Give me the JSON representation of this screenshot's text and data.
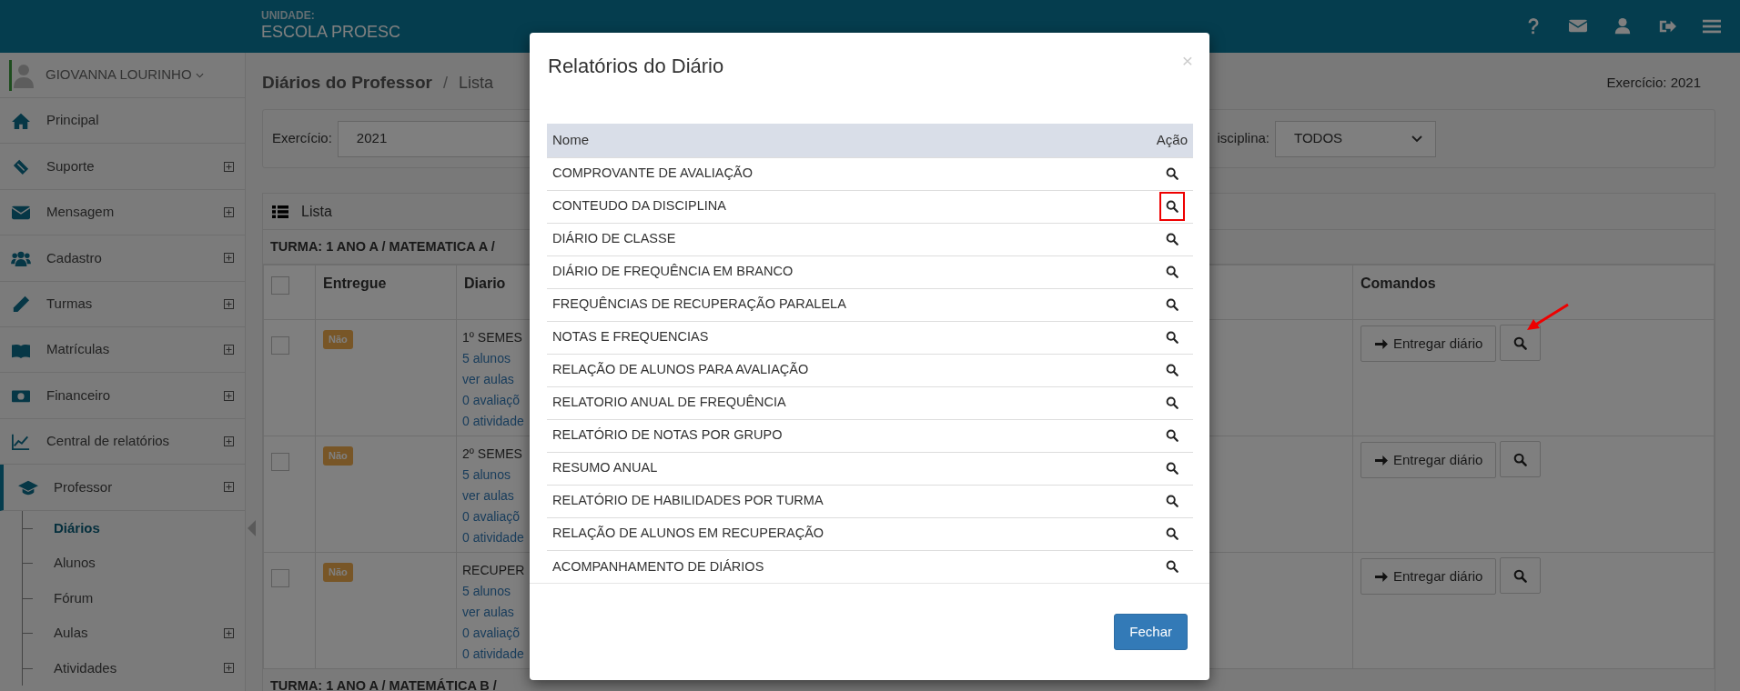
{
  "header": {
    "unit_label": "UNIDADE:",
    "unit_name": "ESCOLA PROESC"
  },
  "user": {
    "name": "GIOVANNA LOURINHO"
  },
  "sidebar": {
    "items": [
      {
        "label": "Principal",
        "expandable": false,
        "selected": false
      },
      {
        "label": "Suporte",
        "expandable": true,
        "selected": false
      },
      {
        "label": "Mensagem",
        "expandable": true,
        "selected": false
      },
      {
        "label": "Cadastro",
        "expandable": true,
        "selected": false
      },
      {
        "label": "Turmas",
        "expandable": true,
        "selected": false
      },
      {
        "label": "Matrículas",
        "expandable": true,
        "selected": false
      },
      {
        "label": "Financeiro",
        "expandable": true,
        "selected": false
      },
      {
        "label": "Central de relatórios",
        "expandable": true,
        "selected": false
      },
      {
        "label": "Professor",
        "expandable": true,
        "selected": true,
        "children": [
          {
            "label": "Diários",
            "expandable": false,
            "selected": true
          },
          {
            "label": "Alunos",
            "expandable": false,
            "selected": false
          },
          {
            "label": "Fórum",
            "expandable": false,
            "selected": false
          },
          {
            "label": "Aulas",
            "expandable": true,
            "selected": false
          },
          {
            "label": "Atividades",
            "expandable": true,
            "selected": false
          }
        ]
      }
    ]
  },
  "breadcrumb": {
    "title": "Diários do Professor",
    "separator": "/",
    "current": "Lista"
  },
  "exercise_label": "Exercício: 2021",
  "filters": [
    {
      "label": "Exercício:",
      "value": "2021"
    },
    {
      "label": "isciplina:",
      "value": "TODOS"
    }
  ],
  "list": {
    "title": "Lista",
    "groups": [
      {
        "title": "TURMA: 1 ANO A / MATEMATICA A /",
        "select_all_checked": false,
        "columns": [
          "Entregue",
          "Diario",
          "Comandos"
        ],
        "rows": [
          {
            "checked": false,
            "delivered": "Não",
            "diary": "1º SEMES",
            "links": [
              "5 alunos",
              "ver aulas",
              "0 avaliaçõ",
              "0 atividade"
            ],
            "deliver_button": "Entregar diário"
          },
          {
            "checked": false,
            "delivered": "Não",
            "diary": "2º SEMES",
            "links": [
              "5 alunos",
              "ver aulas",
              "0 avaliaçõ",
              "0 atividade"
            ],
            "deliver_button": "Entregar diário"
          },
          {
            "checked": false,
            "delivered": "Não",
            "diary": "RECUPER",
            "links": [
              "5 alunos",
              "ver aulas",
              "0 avaliaçõ",
              "0 atividade"
            ],
            "deliver_button": "Entregar diário"
          }
        ]
      },
      {
        "title": "TURMA: 1 ANO A / MATEMÁTICA B /"
      }
    ]
  },
  "modal": {
    "title": "Relatórios do Diário",
    "close": "×",
    "columns": [
      "Nome",
      "Ação"
    ],
    "reports": [
      {
        "name": "COMPROVANTE DE AVALIAÇÃO",
        "highlighted": false
      },
      {
        "name": "CONTEUDO DA DISCIPLINA",
        "highlighted": true
      },
      {
        "name": "DIÁRIO DE CLASSE",
        "highlighted": false
      },
      {
        "name": "DIÁRIO DE FREQUÊNCIA EM BRANCO",
        "highlighted": false
      },
      {
        "name": "FREQUÊNCIAS DE RECUPERAÇÃO PARALELA",
        "highlighted": false
      },
      {
        "name": "NOTAS E FREQUENCIAS",
        "highlighted": false
      },
      {
        "name": "RELAÇÃO DE ALUNOS PARA AVALIAÇÃO",
        "highlighted": false
      },
      {
        "name": "RELATORIO ANUAL DE FREQUÊNCIA",
        "highlighted": false
      },
      {
        "name": "RELATÓRIO DE NOTAS POR GRUPO",
        "highlighted": false
      },
      {
        "name": "RESUMO ANUAL",
        "highlighted": false
      },
      {
        "name": "RELATÓRIO DE HABILIDADES POR TURMA",
        "highlighted": false
      },
      {
        "name": "RELAÇÃO DE ALUNOS EM RECUPERAÇÃO",
        "highlighted": false
      },
      {
        "name": "ACOMPANHAMENTO DE DIÁRIOS",
        "highlighted": false
      }
    ],
    "close_button": "Fechar"
  }
}
